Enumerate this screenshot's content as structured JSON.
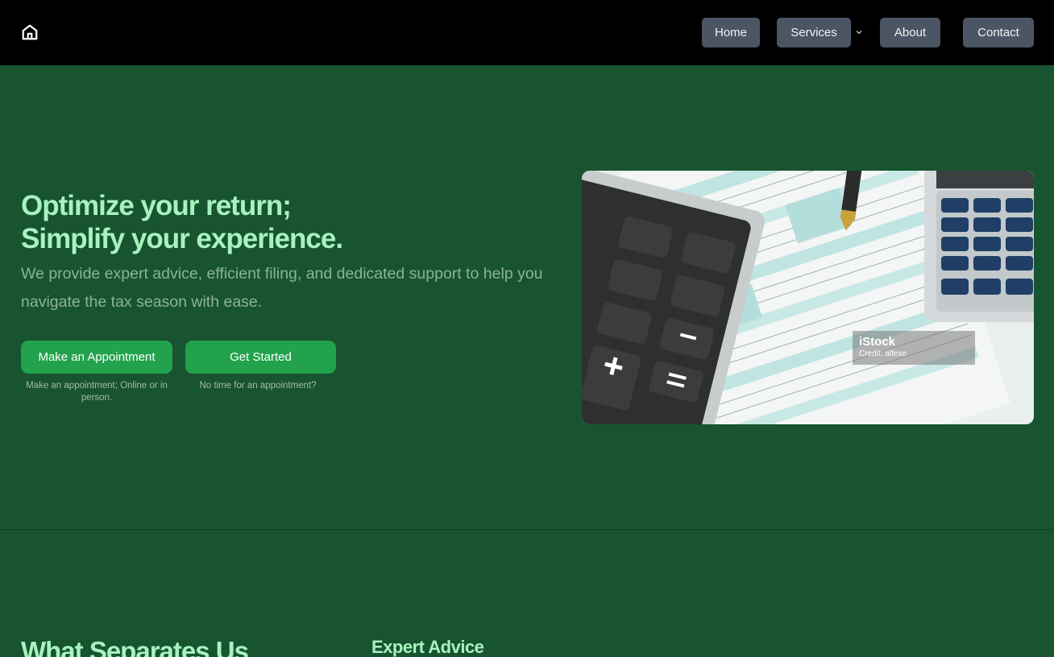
{
  "nav": {
    "home_icon": "house-icon",
    "items": [
      {
        "label": "Home"
      },
      {
        "label": "Services",
        "dropdown_icon": "chevron-down-icon"
      },
      {
        "label": "About"
      },
      {
        "label": "Contact"
      }
    ]
  },
  "hero": {
    "title_line1": "Optimize your return;",
    "title_line2": "Simplify your experience.",
    "subtitle": "We provide expert advice, efficient filing, and dedicated support to help you navigate the tax season with ease.",
    "primary_button": "Make an Appointment",
    "primary_note": "Make an appointment; Online or in person.",
    "secondary_button": "Get Started",
    "secondary_note": "No time for an appointment?",
    "image": {
      "watermark_brand": "iStock",
      "watermark_credit": "Credit: alfexe"
    }
  },
  "section": {
    "title": "What Separates Us",
    "subtitle": "Expert Advice"
  },
  "colors": {
    "nav_bg": "#000000",
    "page_bg": "#18542f",
    "accent_green": "#22a24d",
    "title_green": "#a7f3c0",
    "nav_button": "#4b5563"
  }
}
